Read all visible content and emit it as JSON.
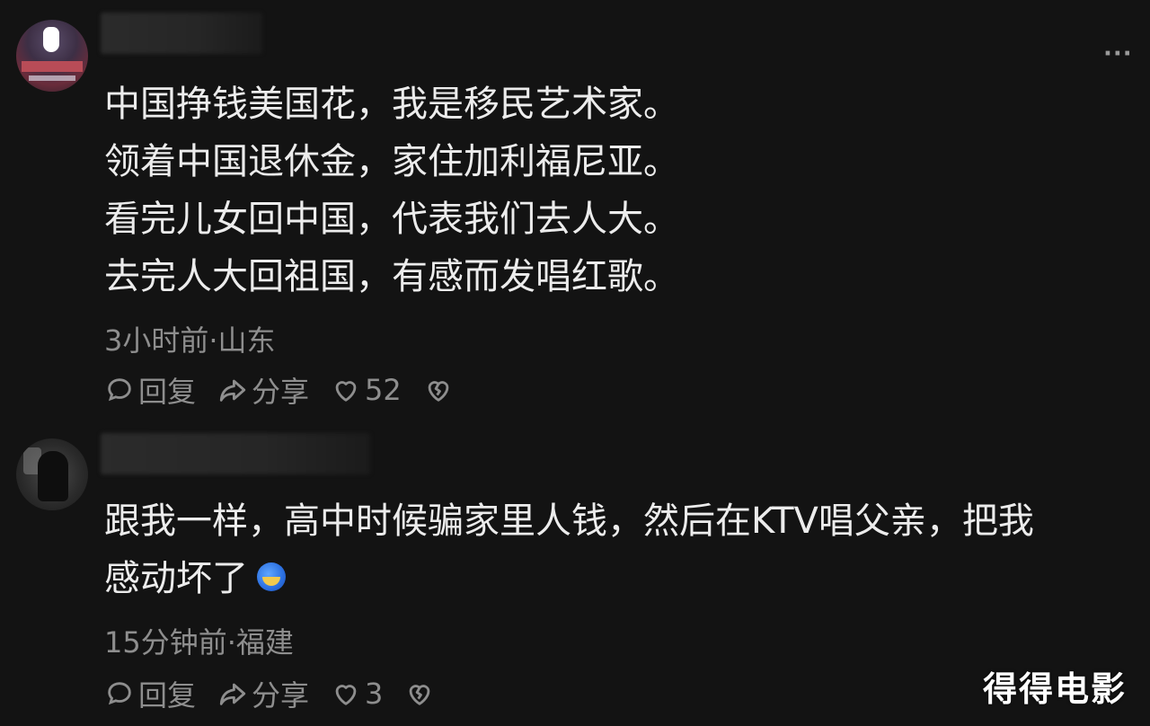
{
  "comments": [
    {
      "lines": [
        "中国挣钱美国花，我是移民艺术家。",
        "领着中国退休金，家住加利福尼亚。",
        "看完儿女回中国，代表我们去人大。",
        "去完人大回祖国，有感而发唱红歌。"
      ],
      "meta": "3小时前·山东",
      "reply_label": "回复",
      "share_label": "分享",
      "like_count": "52"
    },
    {
      "lines": [
        "跟我一样，高中时候骗家里人钱，然后在KTV唱父亲，把我",
        "感动坏了"
      ],
      "meta": "15分钟前·福建",
      "reply_label": "回复",
      "share_label": "分享",
      "like_count": "3"
    }
  ],
  "more_label": "···",
  "watermark": "得得电影",
  "icons": {
    "reply": "comment-icon",
    "share": "share-icon",
    "like": "heart-icon",
    "dislike": "broken-heart-icon",
    "more": "more-dots-icon"
  },
  "colors": {
    "background": "#131313",
    "text": "#ececec",
    "muted": "#8e8e8e"
  }
}
